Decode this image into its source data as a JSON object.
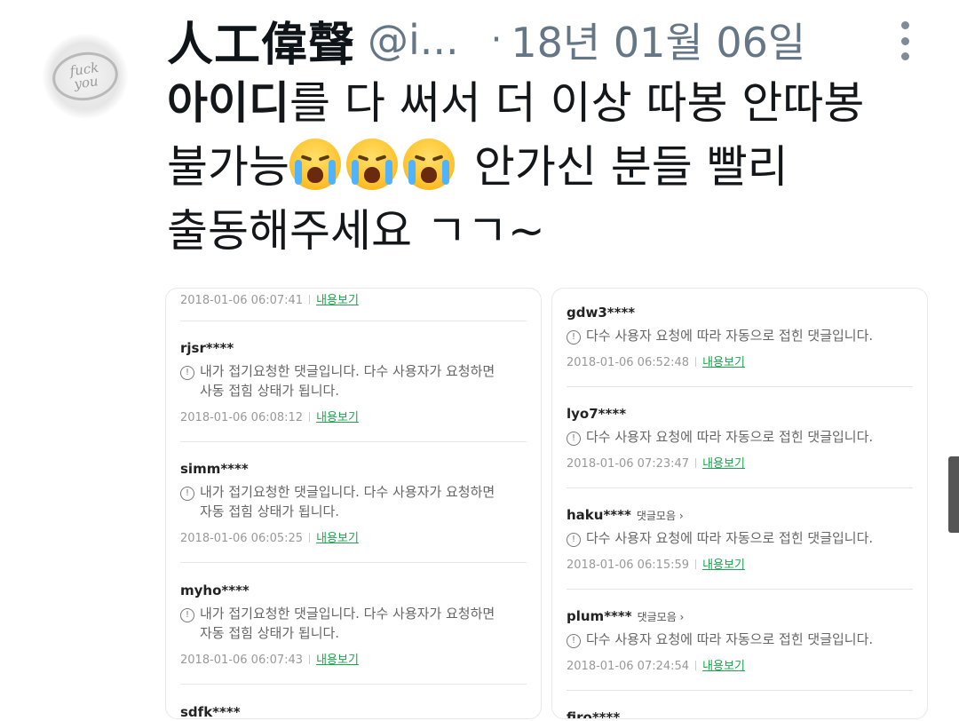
{
  "tweet": {
    "author_name": "人工偉聲",
    "handle": "@i...",
    "separator": "·",
    "date": "18년 01월 06일",
    "text_bold": "아이디",
    "text_line1_rest": "를 다 써서 더 이상 따봉 안따봉",
    "text_line2_start": "불가능",
    "emoji": "loudly-crying-face-emoji",
    "text_line2_end": " 안가신 분들 빨리",
    "text_line3": "출동해주세요 ㄱㄱ~",
    "avatar_text": "fuck you"
  },
  "view_label": "내용보기",
  "left_comments": [
    {
      "user": "",
      "tag": "",
      "msg1": "",
      "msg2": "",
      "time": "2018-01-06 06:07:41"
    },
    {
      "user": "rjsr****",
      "tag": "",
      "msg1": "내가 접기요청한 댓글입니다. 다수 사용자가 요청하면",
      "msg2": "사동 접힘 상태가 됩니다.",
      "time": "2018-01-06 06:08:12"
    },
    {
      "user": "simm****",
      "tag": "",
      "msg1": "내가 접기요청한 댓글입니다. 다수 사용자가 요청하면",
      "msg2": "자동 접힘 상태가 됩니다.",
      "time": "2018-01-06 06:05:25"
    },
    {
      "user": "myho****",
      "tag": "",
      "msg1": "내가 접기요청한 댓글입니다. 다수 사용자가 요청하면",
      "msg2": "자동 접힘 상태가 됩니다.",
      "time": "2018-01-06 06:07:43"
    },
    {
      "user": "sdfk****",
      "tag": "",
      "msg1": "",
      "msg2": "",
      "time": ""
    }
  ],
  "right_comments": [
    {
      "user": "gdw3****",
      "tag": "",
      "msg1": "다수 사용자 요청에 따라 자동으로 접힌 댓글입니다.",
      "time": "2018-01-06 06:52:48"
    },
    {
      "user": "lyo7****",
      "tag": "",
      "msg1": "다수 사용자 요청에 따라 자동으로 접힌 댓글입니다.",
      "time": "2018-01-06 07:23:47"
    },
    {
      "user": "haku****",
      "tag": "댓글모음 ›",
      "msg1": "다수 사용자 요청에 따라 자동으로 접힌 댓글입니다.",
      "time": "2018-01-06 06:15:59"
    },
    {
      "user": "plum****",
      "tag": "댓글모음 ›",
      "msg1": "다수 사용자 요청에 따라 자동으로 접힌 댓글입니다.",
      "time": "2018-01-06 07:24:54"
    },
    {
      "user": "firo****",
      "tag": "",
      "msg1": "",
      "time": ""
    }
  ],
  "warn_glyph": "!",
  "colors": {
    "link_green": "#1aa64b",
    "handle_gray": "#657786"
  }
}
